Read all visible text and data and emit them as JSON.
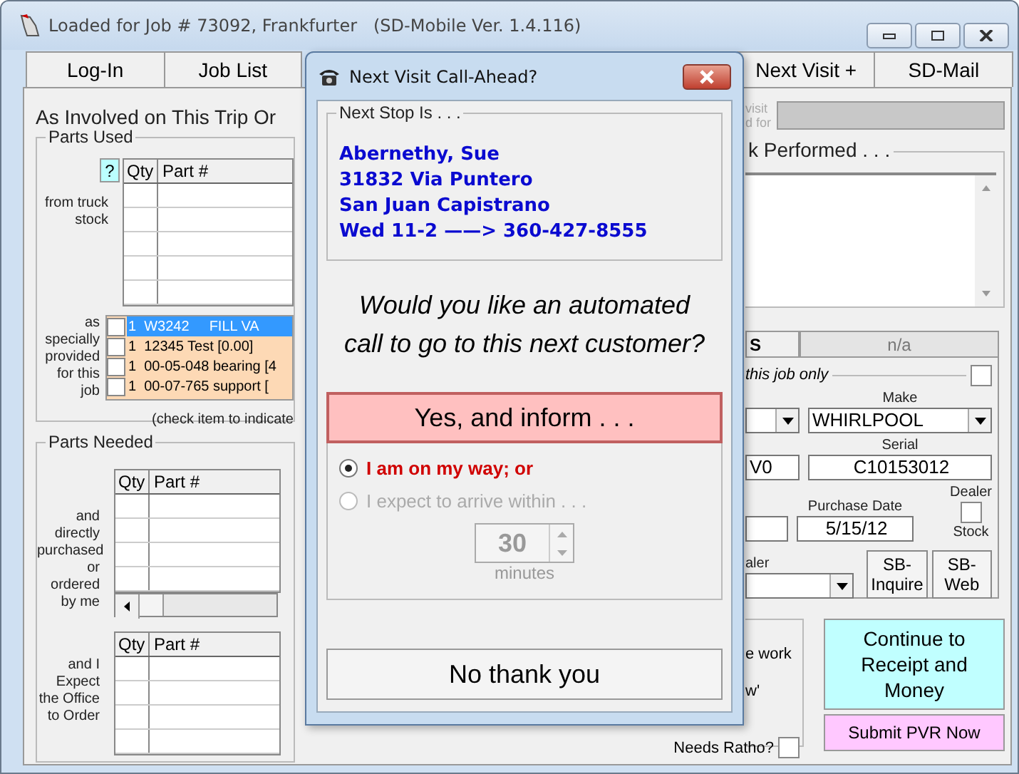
{
  "window": {
    "title": "Loaded for Job # 73092, Frankfurter   (SD-Mobile Ver. 1.4.116)"
  },
  "tabs": [
    {
      "label": "Log-In",
      "selected": false
    },
    {
      "label": "Job List",
      "selected": false
    },
    {
      "label": "Next Visit +",
      "selected": false
    },
    {
      "label": "SD-Mail",
      "selected": false
    }
  ],
  "left": {
    "heading": "As Involved on This Trip Or",
    "parts_used": {
      "title": "Parts Used",
      "help": "?",
      "columns": [
        "Qty",
        "Part #"
      ],
      "truck_label": "from truck stock",
      "special_label": "as specially provided for this job",
      "special_items": [
        {
          "qty": "1",
          "text": "W3242",
          "extra": "FILL VA",
          "selected": true,
          "checked": false
        },
        {
          "qty": "1",
          "text": "12345  Test [0.00]",
          "selected": false,
          "checked": false
        },
        {
          "qty": "1",
          "text": "00-05-048  bearing [4",
          "selected": false,
          "checked": false
        },
        {
          "qty": "1",
          "text": "00-07-765  support [",
          "selected": false,
          "checked": false
        }
      ],
      "hint": "(check item to indicate"
    },
    "parts_needed": {
      "title": "Parts Needed",
      "columns": [
        "Qty",
        "Part #"
      ],
      "purchased_label": "and directly purchased or ordered by me",
      "office_columns": [
        "Qty",
        "Part #"
      ],
      "office_label": "and I Expect the Office to Order"
    }
  },
  "right": {
    "visit_label": [
      "visit",
      "d for"
    ],
    "work_title": "k Performed . . .",
    "subtabs": [
      {
        "label": "S",
        "selected": true
      },
      {
        "label": "n/a",
        "selected": false
      }
    ],
    "legend": "this job only",
    "job_only_checked": false,
    "make_label": "Make",
    "make": "WHIRLPOOL",
    "model_value": "V0",
    "serial_label": "Serial",
    "serial": "C10153012",
    "purchase_label": "Purchase Date",
    "purchase_date": "5/15/12",
    "dealer_label": "Dealer",
    "stock_label": "Stock",
    "stock_checked": false,
    "dealer_field_label": "aler",
    "sb_buttons": [
      "SB-Inquire",
      "SB-Web"
    ],
    "notes": [
      "e work",
      "w'"
    ],
    "ratho_label": "Needs Ratho?",
    "ratho_checked": false,
    "continue_button": "Continue to Receipt and Money",
    "submit_button": "Submit PVR Now"
  },
  "dialog": {
    "title": "Next Visit Call-Ahead?",
    "stop_title": "Next Stop Is . . .",
    "stop_lines": [
      "Abernethy, Sue",
      "31832 Via Puntero",
      "San Juan Capistrano",
      "Wed 11-2 ——> 360-427-8555"
    ],
    "question": "Would you like an automated call to go to this next customer?",
    "yes_button": "Yes, and inform . . .",
    "options": [
      {
        "label": "I am on my way; or",
        "selected": true,
        "disabled": false
      },
      {
        "label": "I expect to arrive within . . .",
        "selected": false,
        "disabled": true
      }
    ],
    "minutes_value": "30",
    "minutes_label": "minutes",
    "minutes_disabled": true,
    "no_button": "No thank you"
  }
}
